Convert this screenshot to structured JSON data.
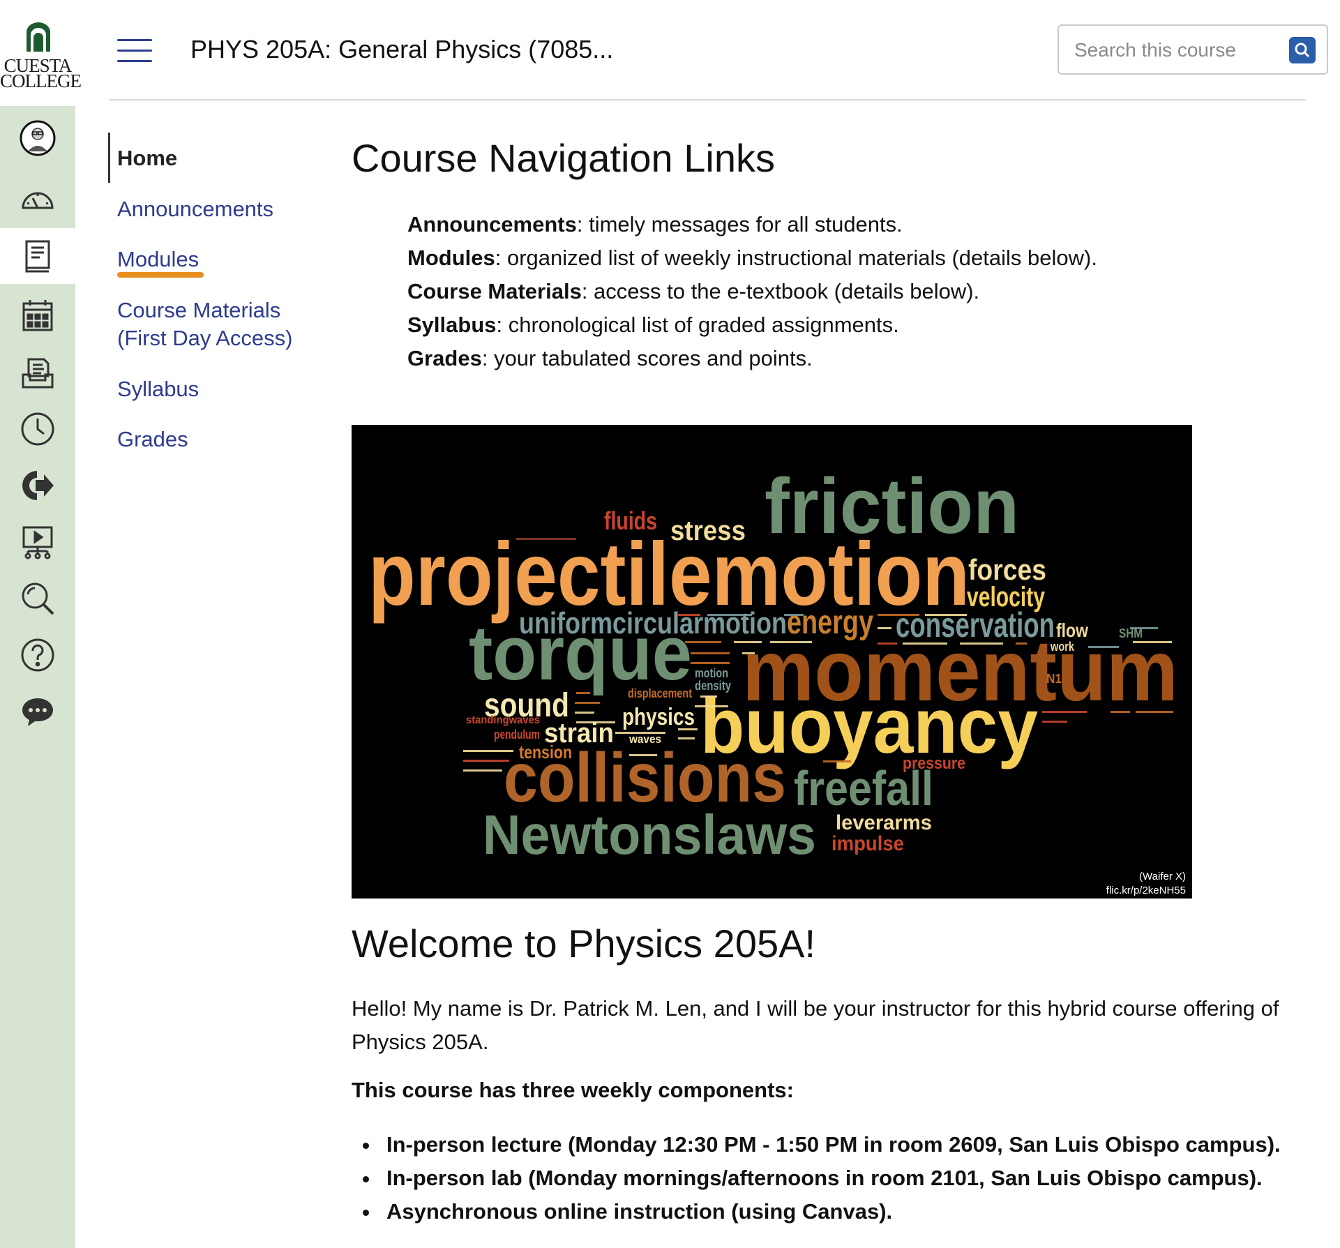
{
  "brand": {
    "logo_line1": "CUESTA",
    "logo_line2": "COLLEGE",
    "rail_color": "#d8e4d2",
    "link_color": "#2d3b8f",
    "accent_orange": "#e98f1f"
  },
  "global_nav": [
    {
      "icon": "avatar-icon"
    },
    {
      "icon": "dashboard-icon"
    },
    {
      "icon": "courses-icon",
      "active": true
    },
    {
      "icon": "calendar-icon"
    },
    {
      "icon": "inbox-icon"
    },
    {
      "icon": "history-icon"
    },
    {
      "icon": "commons-icon"
    },
    {
      "icon": "studio-icon"
    },
    {
      "icon": "search-icon"
    },
    {
      "icon": "help-icon"
    },
    {
      "icon": "chat-icon"
    }
  ],
  "header": {
    "course_title": "PHYS 205A: General Physics (7085...",
    "search_placeholder": "Search this course"
  },
  "course_nav": {
    "home": "Home",
    "announcements": "Announcements",
    "modules": "Modules",
    "course_materials_1": "Course Materials",
    "course_materials_2": "(First Day Access)",
    "syllabus": "Syllabus",
    "grades": "Grades"
  },
  "main": {
    "heading": "Course Navigation Links",
    "definitions": [
      {
        "term": "Announcements",
        "desc": ": timely messages for all students."
      },
      {
        "term": "Modules",
        "desc": ": organized list of weekly instructional materials (details below)."
      },
      {
        "term": "Course Materials",
        "desc": ": access to the e-textbook (details below)."
      },
      {
        "term": "Syllabus",
        "desc": ": chronological list of graded assignments."
      },
      {
        "term": "Grades",
        "desc": ": your tabulated scores and points."
      }
    ],
    "wordcloud": {
      "credit_line1": "(Waifer X)",
      "credit_line2": "flic.kr/p/2keNH55",
      "words": {
        "friction": "friction",
        "fluids": "fluids",
        "stress": "stress",
        "projectilemotion": "projectilemotion",
        "forces": "forces",
        "velocity": "velocity",
        "uniformcircularmotion": "uniformcircularmotion",
        "energy": "energy",
        "conservation": "conservation",
        "flow": "flow",
        "work": "work",
        "shm": "SHM",
        "torque": "torque",
        "momentum": "momentum",
        "sound": "sound",
        "physics": "physics",
        "displacement": "displacement",
        "motion": "motion",
        "density": "density",
        "standingwaves": "standingwaves",
        "pendulum": "pendulum",
        "strain": "strain",
        "waves": "waves",
        "tension": "tension",
        "buoyancy": "buoyancy",
        "collisions": "collisions",
        "freefall": "freefall",
        "pressure": "pressure",
        "newtonslaws": "Newtonslaws",
        "leverarms": "leverarms",
        "impulse": "impulse",
        "n1": "N1"
      }
    },
    "welcome_heading": "Welcome to Physics 205A!",
    "intro": "Hello! My name is Dr. Patrick M. Len, and I will be your instructor for this hybrid course offering of Physics 205A.",
    "components_heading": "This course has three weekly components:",
    "components": [
      "In-person lecture (Monday 12:30 PM - 1:50 PM in room 2609, San Luis Obispo campus).",
      "In-person lab (Monday mornings/afternoons in room 2101, San Luis Obispo campus).",
      "Asynchronous online instruction (using Canvas)."
    ]
  }
}
